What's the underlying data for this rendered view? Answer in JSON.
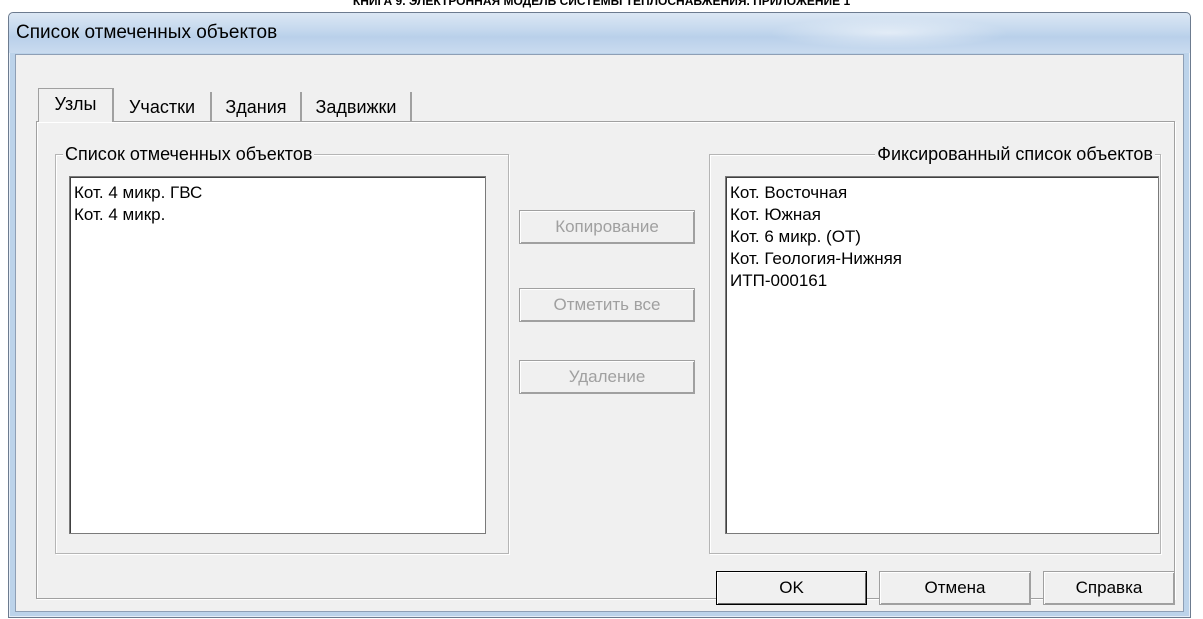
{
  "document_header": "КНИГА 9. ЭЛЕКТРОННАЯ МОДЕЛЬ СИСТЕМЫ ТЕПЛОСНАБЖЕНИЯ. ПРИЛОЖЕНИЕ 1",
  "window": {
    "title": "Список отмеченных объектов"
  },
  "tabs": [
    {
      "label": "Узлы",
      "active": true
    },
    {
      "label": "Участки",
      "active": false
    },
    {
      "label": "Здания",
      "active": false
    },
    {
      "label": "Задвижки",
      "active": false
    }
  ],
  "marked_group": {
    "label": "Список отмеченных объектов",
    "items": [
      "Кот. 4 микр. ГВС",
      "Кот. 4 микр."
    ]
  },
  "fixed_group": {
    "label": "Фиксированный список объектов",
    "items": [
      "Кот. Восточная",
      "Кот. Южная",
      "Кот. 6 микр. (ОТ)",
      "Кот. Геология-Нижняя",
      "ИТП-000161"
    ]
  },
  "actions": {
    "copy": "Копирование",
    "mark_all": "Отметить все",
    "delete": "Удаление"
  },
  "footer": {
    "ok": "OK",
    "cancel": "Отмена",
    "help": "Справка"
  }
}
